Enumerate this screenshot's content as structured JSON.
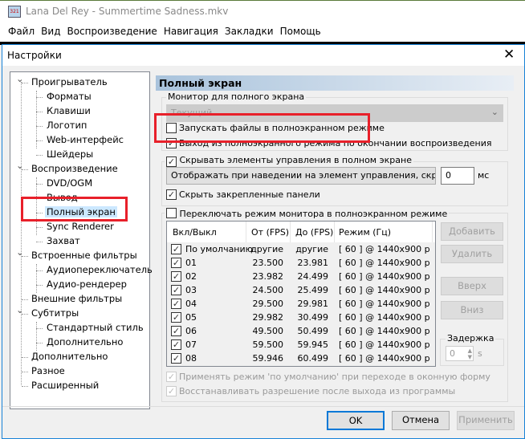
{
  "app": {
    "title": "Lana Del Rey - Summertime Sadness.mkv",
    "menu": [
      "Файл",
      "Вид",
      "Воспроизведение",
      "Навигация",
      "Закладки",
      "Помощь"
    ]
  },
  "dialog": {
    "title": "Настройки",
    "close": "✕"
  },
  "tree": [
    {
      "label": "Проигрыватель",
      "level": 0,
      "expanded": true
    },
    {
      "label": "Форматы",
      "level": 1
    },
    {
      "label": "Клавиши",
      "level": 1
    },
    {
      "label": "Логотип",
      "level": 1
    },
    {
      "label": "Web-интерфейс",
      "level": 1
    },
    {
      "label": "Шейдеры",
      "level": 1
    },
    {
      "label": "Воспроизведение",
      "level": 0,
      "expanded": true
    },
    {
      "label": "DVD/OGM",
      "level": 1
    },
    {
      "label": "Вывод",
      "level": 1
    },
    {
      "label": "Полный экран",
      "level": 1,
      "selected": true
    },
    {
      "label": "Sync Renderer",
      "level": 1
    },
    {
      "label": "Захват",
      "level": 1
    },
    {
      "label": "Встроенные фильтры",
      "level": 0,
      "expanded": true
    },
    {
      "label": "Аудиопереключатель",
      "level": 1
    },
    {
      "label": "Аудио-рендерер",
      "level": 1
    },
    {
      "label": "Внешние фильтры",
      "level": 0
    },
    {
      "label": "Субтитры",
      "level": 0,
      "expanded": true
    },
    {
      "label": "Стандартный стиль",
      "level": 1
    },
    {
      "label": "Дополнительно",
      "level": 1
    },
    {
      "label": "Дополнительно",
      "level": 0
    },
    {
      "label": "Разное",
      "level": 0
    },
    {
      "label": "Расширенный",
      "level": 0
    }
  ],
  "panel": {
    "title": "Полный экран",
    "monitor_group": "Монитор для полного экрана",
    "monitor_value": "Текущий",
    "launch_fullscreen": {
      "label": "Запускать файлы в полноэкранном режиме",
      "checked": false
    },
    "exit_fullscreen": {
      "label": "Выход из полноэкранного режима по окончании воспроизведения",
      "checked": true
    },
    "hide_controls": {
      "label": "Скрывать элементы управления в полном экране",
      "checked": true
    },
    "hide_mode": "Отображать при наведении на элемент управления, скрыть",
    "hide_delay": "0",
    "ms": "мс",
    "hide_docked": {
      "label": "Скрыть закрепленные панели",
      "checked": true
    },
    "switch_mode": {
      "label": "Переключать режим монитора в полноэкранном режиме",
      "checked": false
    },
    "columns": [
      "Вкл/Выкл",
      "От (FPS)",
      "До (FPS)",
      "Режим (Гц)"
    ],
    "rows": [
      [
        "По умолчанию",
        "другие",
        "другие",
        "[ 60 ] @ 1440x900 p"
      ],
      [
        "01",
        "23.500",
        "23.981",
        "[ 60 ] @ 1440x900 p"
      ],
      [
        "02",
        "23.982",
        "24.499",
        "[ 60 ] @ 1440x900 p"
      ],
      [
        "03",
        "24.500",
        "25.499",
        "[ 60 ] @ 1440x900 p"
      ],
      [
        "04",
        "29.500",
        "29.981",
        "[ 60 ] @ 1440x900 p"
      ],
      [
        "05",
        "29.982",
        "30.499",
        "[ 60 ] @ 1440x900 p"
      ],
      [
        "06",
        "49.500",
        "50.499",
        "[ 60 ] @ 1440x900 p"
      ],
      [
        "07",
        "59.500",
        "59.945",
        "[ 60 ] @ 1440x900 p"
      ],
      [
        "08",
        "59.946",
        "60.499",
        "[ 60 ] @ 1440x900 p"
      ]
    ],
    "buttons": {
      "add": "Добавить",
      "remove": "Удалить",
      "up": "Вверх",
      "down": "Вниз"
    },
    "delay_label": "Задержка",
    "delay_value": "0",
    "delay_unit": "s",
    "apply_default": "Применять режим 'по умолчанию' при переходе в оконную форму",
    "restore_res": "Восстанавливать разрешение после выхода из программы"
  },
  "footer": {
    "ok": "OK",
    "cancel": "Отмена",
    "apply": "Применить"
  }
}
